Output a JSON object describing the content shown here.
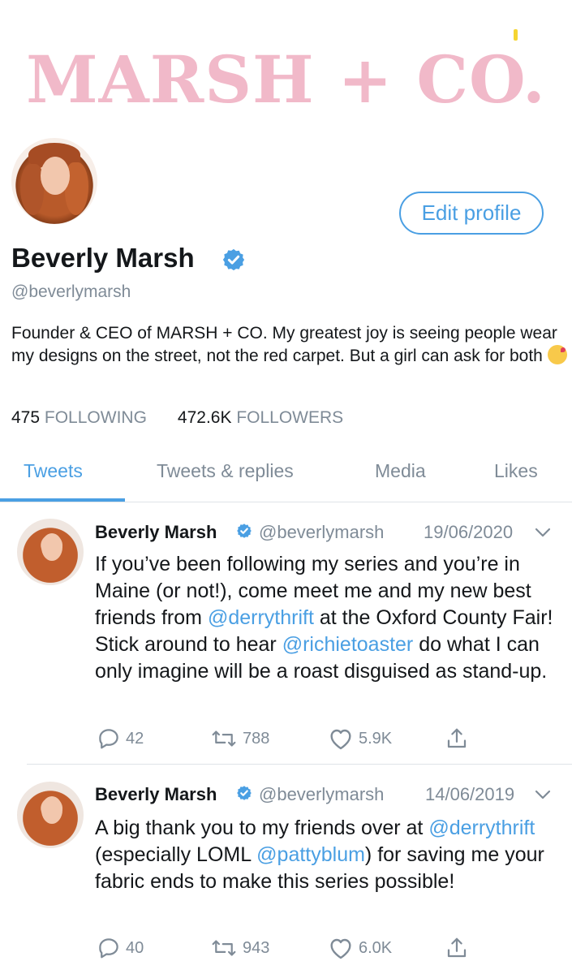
{
  "banner": {
    "logo_text": "MARSH + CO.",
    "logo_color": "#f1b9c9"
  },
  "profile": {
    "edit_button": "Edit profile",
    "name": "Beverly Marsh",
    "handle": "@beverlymarsh",
    "bio": "Founder & CEO of MARSH + CO. My greatest joy is seeing people wear my designs on the street, not the red carpet. But a girl can ask for both",
    "bio_emoji": "face-blowing-kiss",
    "following_count": "475",
    "following_label": "FOLLOWING",
    "followers_count": "472.6K",
    "followers_label": "FOLLOWERS"
  },
  "tabs": [
    {
      "label": "Tweets",
      "active": true
    },
    {
      "label": "Tweets & replies",
      "active": false
    },
    {
      "label": "Media",
      "active": false
    },
    {
      "label": "Likes",
      "active": false
    }
  ],
  "tweets": [
    {
      "name": "Beverly Marsh",
      "handle": "@beverlymarsh",
      "date": "19/06/2020",
      "text_parts": [
        {
          "t": "If you’ve been following my series and you’re in Maine (or not!), come meet me and my new best friends from ",
          "m": false
        },
        {
          "t": "@derrythrift",
          "m": true
        },
        {
          "t": " at the Oxford County Fair! Stick around to hear ",
          "m": false
        },
        {
          "t": "@richietoaster",
          "m": true
        },
        {
          "t": " do what I can only imagine will be a roast disguised as stand-up.",
          "m": false
        }
      ],
      "replies": "42",
      "retweets": "788",
      "likes": "5.9K"
    },
    {
      "name": "Beverly Marsh",
      "handle": "@beverlymarsh",
      "date": "14/06/2019",
      "text_parts": [
        {
          "t": "A big thank you to my friends over at ",
          "m": false
        },
        {
          "t": "@derrythrift",
          "m": true
        },
        {
          "t": " (especially LOML ",
          "m": false
        },
        {
          "t": "@pattyblum",
          "m": true
        },
        {
          "t": ") for saving me your fabric ends to make this series possible!",
          "m": false
        }
      ],
      "replies": "40",
      "retweets": "943",
      "likes": "6.0K"
    }
  ],
  "colors": {
    "accent": "#4a9fe3",
    "muted": "#7f8b97",
    "text": "#14171a",
    "divider": "#dfe3e7"
  }
}
